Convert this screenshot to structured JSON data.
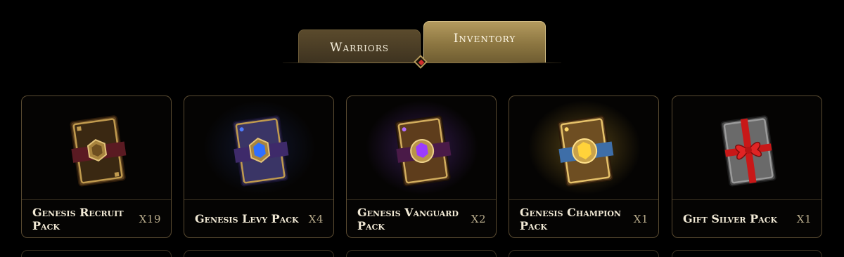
{
  "tabs": [
    {
      "label": "Warriors",
      "active": false
    },
    {
      "label": "Inventory",
      "active": true
    }
  ],
  "colors": {
    "accent_gold": "#b39a5e",
    "card_border": "#5a4b31",
    "indicator_red": "#d22c2c"
  },
  "cards": [
    {
      "name": "Genesis Recruit Pack",
      "quantity": "X19",
      "icon": "recruit-pack-icon",
      "gem_color": "#8a6a2e"
    },
    {
      "name": "Genesis Levy Pack",
      "quantity": "X4",
      "icon": "levy-pack-icon",
      "gem_color": "#2f6fff"
    },
    {
      "name": "Genesis Vanguard Pack",
      "quantity": "X2",
      "icon": "vanguard-pack-icon",
      "gem_color": "#9b3cff"
    },
    {
      "name": "Genesis Champion Pack",
      "quantity": "X1",
      "icon": "champion-pack-icon",
      "gem_color": "#ffd23a"
    },
    {
      "name": "Gift Silver Pack",
      "quantity": "X1",
      "icon": "gift-pack-icon",
      "gem_color": "#d21d1d"
    }
  ]
}
